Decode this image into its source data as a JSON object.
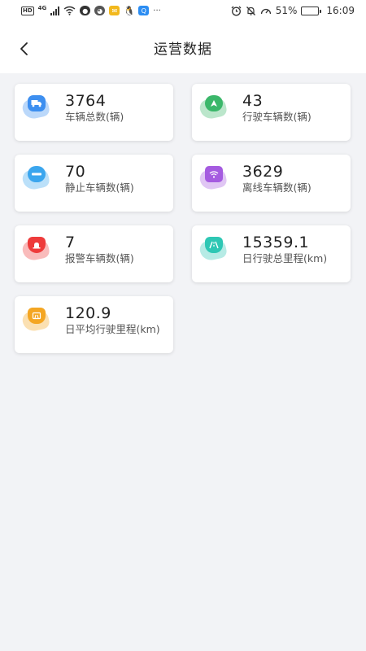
{
  "status_bar": {
    "hd": "HD",
    "network": "4G",
    "battery_percent": "51%",
    "battery_level": 0.51,
    "time": "16:09",
    "more": "···"
  },
  "navbar": {
    "title": "运营数据"
  },
  "cards": [
    {
      "value": "3764",
      "label": "车辆总数(辆)",
      "color": "#3d8ff0",
      "icon": "truck-icon"
    },
    {
      "value": "43",
      "label": "行驶车辆数(辆)",
      "color": "#3bb76a",
      "icon": "navigation-arrow-icon"
    },
    {
      "value": "70",
      "label": "静止车辆数(辆)",
      "color": "#3ba6ee",
      "icon": "minus-icon"
    },
    {
      "value": "3629",
      "label": "离线车辆数(辆)",
      "color": "#a55be0",
      "icon": "wifi-icon"
    },
    {
      "value": "7",
      "label": "报警车辆数(辆)",
      "color": "#ee3b3b",
      "icon": "alarm-light-icon"
    },
    {
      "value": "15359.1",
      "label": "日行驶总里程(km)",
      "color": "#2ec7b4",
      "icon": "road-icon"
    },
    {
      "value": "120.9",
      "label": "日平均行驶里程(km)",
      "color": "#f4a623",
      "icon": "calendar-road-icon"
    }
  ]
}
